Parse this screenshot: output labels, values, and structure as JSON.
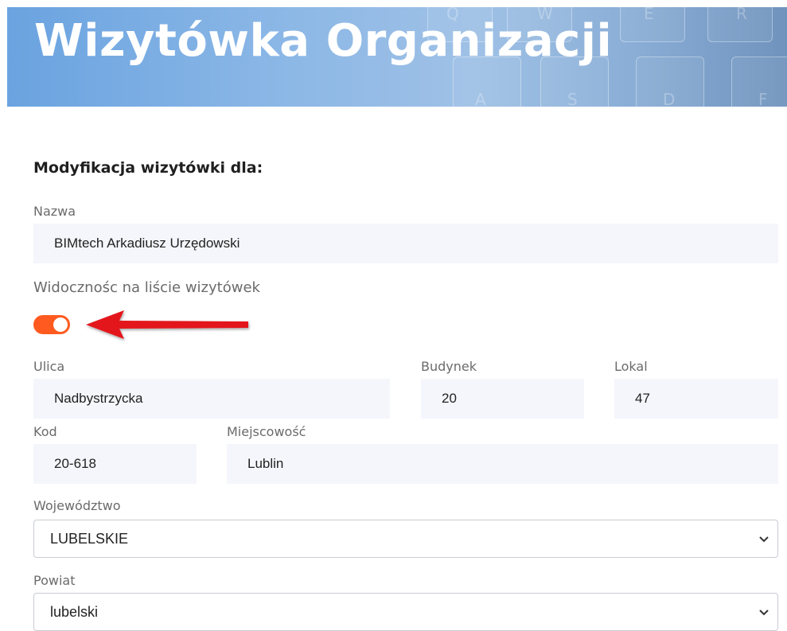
{
  "banner": {
    "title": "Wizytówka Organizacji"
  },
  "form": {
    "section_title": "Modyfikacja wizytówki dla:",
    "nazwa": {
      "label": "Nazwa",
      "value": "BIMtech Arkadiusz Urzędowski"
    },
    "visibility": {
      "label": "Widocznośc na liście wizytówek",
      "enabled": true
    },
    "ulica": {
      "label": "Ulica",
      "value": "Nadbystrzycka"
    },
    "budynek": {
      "label": "Budynek",
      "value": "20"
    },
    "lokal": {
      "label": "Lokal",
      "value": "47"
    },
    "kod": {
      "label": "Kod",
      "value": "20-618"
    },
    "miejscowosc": {
      "label": "Miejscowość",
      "value": "Lublin"
    },
    "wojewodztwo": {
      "label": "Województwo",
      "value": "LUBELSKIE"
    },
    "powiat": {
      "label": "Powiat",
      "value": "lubelski"
    }
  },
  "colors": {
    "accent_toggle": "#ff5a1f",
    "arrow": "#e3161a",
    "banner_blue": "#7fb0e6",
    "field_bg": "#f5f6fb"
  },
  "icons": {
    "select_indicator": "chevron-down-icon",
    "annotation": "red-arrow-icon"
  }
}
